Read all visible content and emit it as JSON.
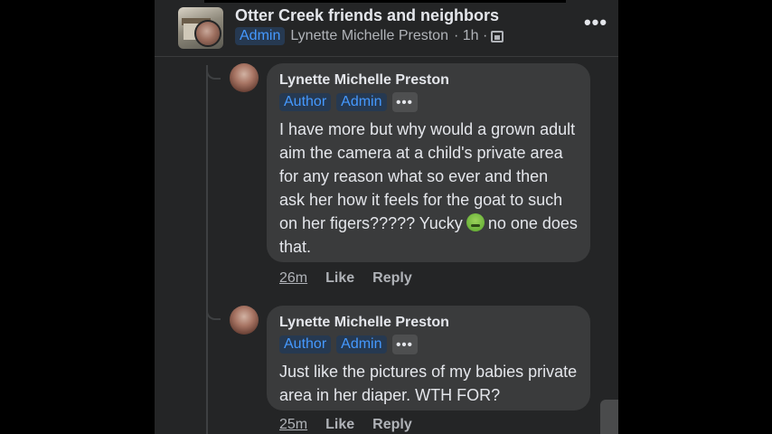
{
  "header": {
    "group_name": "Otter Creek friends and neighbors",
    "admin_badge": "Admin",
    "poster": "Lynette Michelle Preston",
    "time": "· 1h ·",
    "more_icon": "•••"
  },
  "comments": [
    {
      "author": "Lynette Michelle Preston",
      "badges": [
        "Author",
        "Admin"
      ],
      "more_icon": "•••",
      "text_before_emoji": "I have more but why would a grown adult aim the camera at a child's private area for any reason what so ever and then ask her how it feels for the goat to such on her figers????? Yucky",
      "emoji": "nauseated-face-icon",
      "text_after_emoji": "no one does that.",
      "time": "26m",
      "like": "Like",
      "reply": "Reply"
    },
    {
      "author": "Lynette Michelle Preston",
      "badges": [
        "Author",
        "Admin"
      ],
      "more_icon": "•••",
      "text": "Just like the pictures of my babies private area in her diaper. WTH FOR?",
      "time": "25m",
      "like": "Like",
      "reply": "Reply"
    }
  ],
  "colors": {
    "background": "#242526",
    "bubble": "#3a3b3c",
    "badge_text": "#4599ff",
    "secondary_text": "#b0b3b8"
  }
}
